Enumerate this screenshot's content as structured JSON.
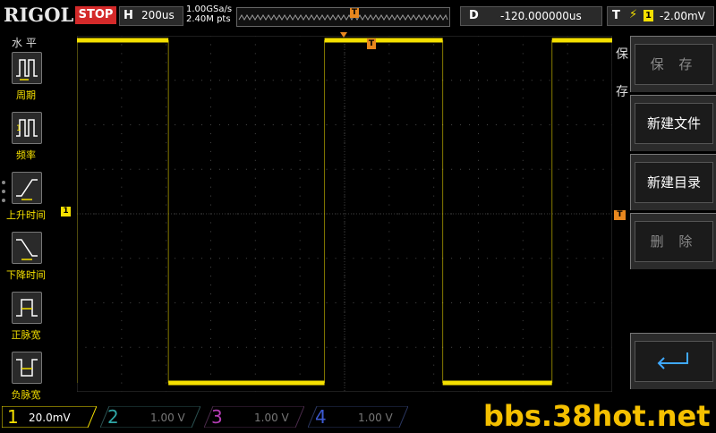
{
  "brand": "RIGOL",
  "run_state": "STOP",
  "horizontal": {
    "key": "H",
    "timebase": "200us"
  },
  "acquisition": {
    "sample_rate": "1.00GSa/s",
    "memory_depth": "2.40M pts"
  },
  "trigger_position_marker": "T",
  "delay": {
    "key": "D",
    "value": "-120.000000us"
  },
  "trigger": {
    "key": "T",
    "edge_symbol": "⚡",
    "source": "1",
    "level": "-2.00mV"
  },
  "left_menu": {
    "title": "水 平",
    "items": [
      {
        "label": "周期",
        "icon": "period-icon"
      },
      {
        "label": "频率",
        "icon": "frequency-icon"
      },
      {
        "label": "上升时间",
        "icon": "rise-time-icon"
      },
      {
        "label": "下降时间",
        "icon": "fall-time-icon"
      },
      {
        "label": "正脉宽",
        "icon": "positive-width-icon"
      },
      {
        "label": "负脉宽",
        "icon": "negative-width-icon"
      }
    ]
  },
  "right_menu": {
    "title": "保存",
    "buttons": [
      {
        "label": "保 存",
        "state": "disabled"
      },
      {
        "label": "新建文件",
        "state": "active"
      },
      {
        "label": "新建目录",
        "state": "active"
      },
      {
        "label": "删 除",
        "state": "disabled"
      },
      {
        "icon": "return-icon"
      }
    ]
  },
  "waveform": {
    "channel": "1",
    "channel_marker": "1",
    "trigger_level_marker": "T",
    "color": "#f5e000",
    "high_level_div": 3.9,
    "low_level_div": -3.8,
    "edges_div": [
      0.0,
      2.05,
      5.55,
      8.2,
      10.65,
      13.0
    ],
    "start_state": "low"
  },
  "channels": [
    {
      "num": "1",
      "scale": "20.0mV",
      "color": "#f5e000",
      "active": true
    },
    {
      "num": "2",
      "scale": "1.00 V",
      "color": "#2fa6a6",
      "active": false
    },
    {
      "num": "3",
      "scale": "1.00 V",
      "color": "#b43cb4",
      "active": false
    },
    {
      "num": "4",
      "scale": "1.00 V",
      "color": "#3c5ad2",
      "active": false
    }
  ],
  "watermark": "bbs.38hot.net"
}
